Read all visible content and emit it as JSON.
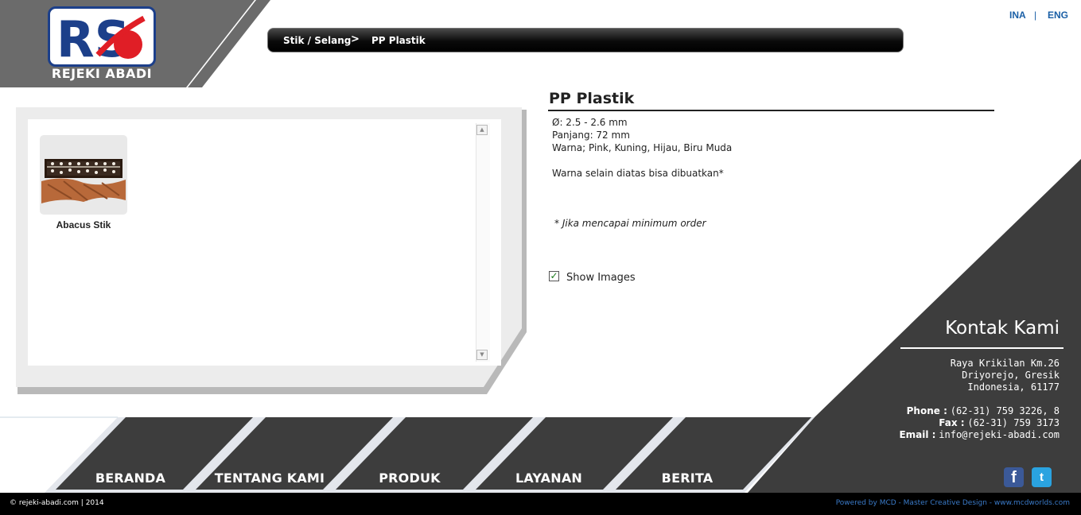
{
  "brand": {
    "logo_letters": "RS",
    "name": "REJEKI ABADI"
  },
  "language": {
    "ina": "INA",
    "separator": "|",
    "eng": "ENG"
  },
  "breadcrumb": {
    "category": "Stik / Selang",
    "separator": ">",
    "current": "PP Plastik"
  },
  "product_list": [
    {
      "name": "Abacus Stik"
    }
  ],
  "product": {
    "title": "PP Plastik",
    "specs": [
      "Ø: 2.5 - 2.6 mm",
      "Panjang: 72 mm",
      "Warna; Pink, Kuning, Hijau, Biru Muda",
      "Warna selain diatas bisa dibuatkan*"
    ],
    "note": "* Jika mencapai minimum order",
    "show_images": {
      "label": "Show Images",
      "checked": true
    }
  },
  "contact": {
    "title": "Kontak Kami",
    "address": [
      "Raya Krikilan Km.26",
      "Driyorejo, Gresik",
      "Indonesia, 61177"
    ],
    "phone_label": "Phone :",
    "phone": "(62-31) 759 3226, 8",
    "fax_label": "Fax :",
    "fax": "(62-31) 759 3173",
    "email_label": "Email :",
    "email": "info@rejeki-abadi.com"
  },
  "nav": [
    "BERANDA",
    "TENTANG KAMI",
    "PRODUK",
    "LAYANAN",
    "BERITA"
  ],
  "social": {
    "facebook": "f",
    "twitter": "t"
  },
  "footer": {
    "copyright": "© rejeki-abadi.com | 2014",
    "powered": "Powered by MCD - Master Creative Design - www.mcdworlds.com"
  },
  "colors": {
    "dark": "#3d3d3d",
    "mid": "#6b6b6b",
    "link": "#1a5fa6",
    "facebook": "#3b5998",
    "twitter": "#2aa3e0"
  }
}
